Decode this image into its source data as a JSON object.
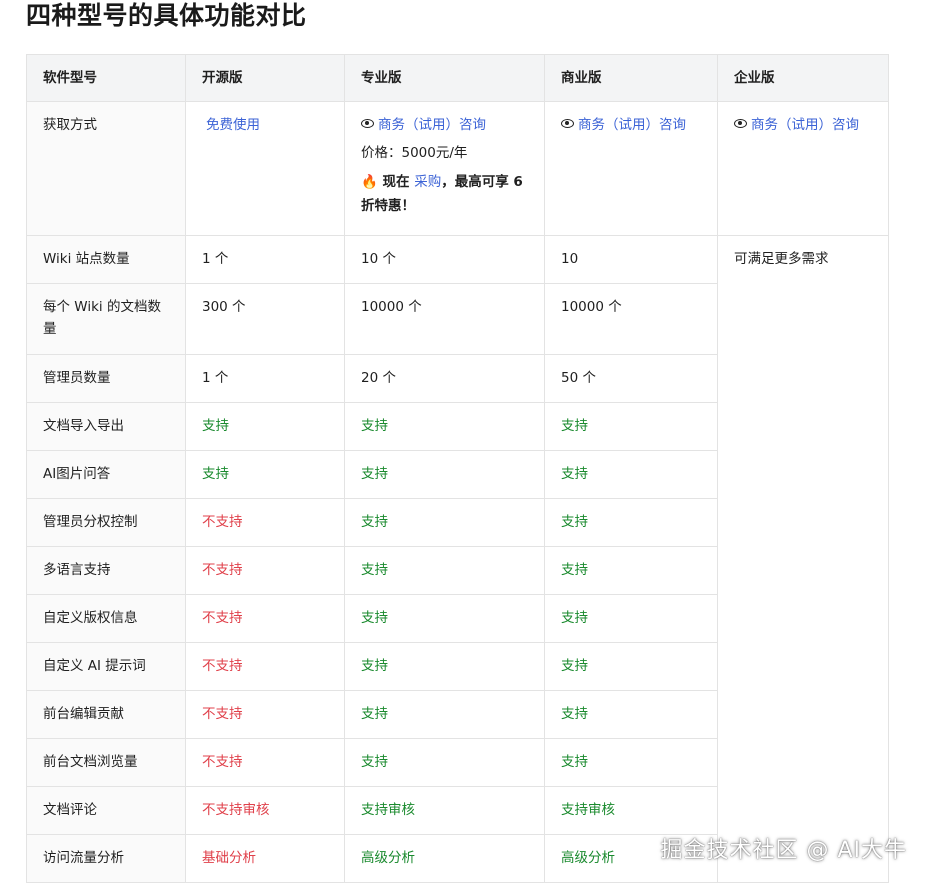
{
  "page_title": "四种型号的具体功能对比",
  "colors": {
    "supported": "#1a8a2e",
    "unsupported": "#e0414b",
    "link": "#3c63d6"
  },
  "table": {
    "headers": [
      "软件型号",
      "开源版",
      "专业版",
      "商业版",
      "企业版"
    ],
    "acquire": {
      "label": "获取方式",
      "open": "免费使用",
      "pro_link": "商务（试用）咨询",
      "pro_price": "价格：5000元/年",
      "promo_prefix": "现在",
      "promo_link": "采购",
      "promo_suffix": "，最高可享 6 折特惠！",
      "biz_link": "商务（试用）咨询",
      "ent_link": "商务（试用）咨询"
    },
    "enterprise_note": "可满足更多需求",
    "rows": [
      {
        "label": "Wiki 站点数量",
        "open": "1 个",
        "pro": "10 个",
        "biz": "10"
      },
      {
        "label": "每个 Wiki 的文档数量",
        "open": "300 个",
        "pro": "10000 个",
        "biz": "10000 个"
      },
      {
        "label": "管理员数量",
        "open": "1 个",
        "pro": "20 个",
        "biz": "50 个"
      },
      {
        "label": "文档导入导出",
        "open": "支持",
        "pro": "支持",
        "biz": "支持"
      },
      {
        "label": "AI图片问答",
        "open": "支持",
        "pro": "支持",
        "biz": "支持"
      },
      {
        "label": "管理员分权控制",
        "open": "不支持",
        "pro": "支持",
        "biz": "支持"
      },
      {
        "label": "多语言支持",
        "open": "不支持",
        "pro": "支持",
        "biz": "支持"
      },
      {
        "label": "自定义版权信息",
        "open": "不支持",
        "pro": "支持",
        "biz": "支持"
      },
      {
        "label": "自定义 AI 提示词",
        "open": "不支持",
        "pro": "支持",
        "biz": "支持"
      },
      {
        "label": "前台编辑贡献",
        "open": "不支持",
        "pro": "支持",
        "biz": "支持"
      },
      {
        "label": "前台文档浏览量",
        "open": "不支持",
        "pro": "支持",
        "biz": "支持"
      },
      {
        "label": "文档评论",
        "open": "不支持审核",
        "pro": "支持审核",
        "biz": "支持审核"
      },
      {
        "label": "访问流量分析",
        "open": "基础分析",
        "pro": "高级分析",
        "biz": "高级分析"
      }
    ]
  },
  "watermark": "掘金技术社区 @ AI大牛"
}
